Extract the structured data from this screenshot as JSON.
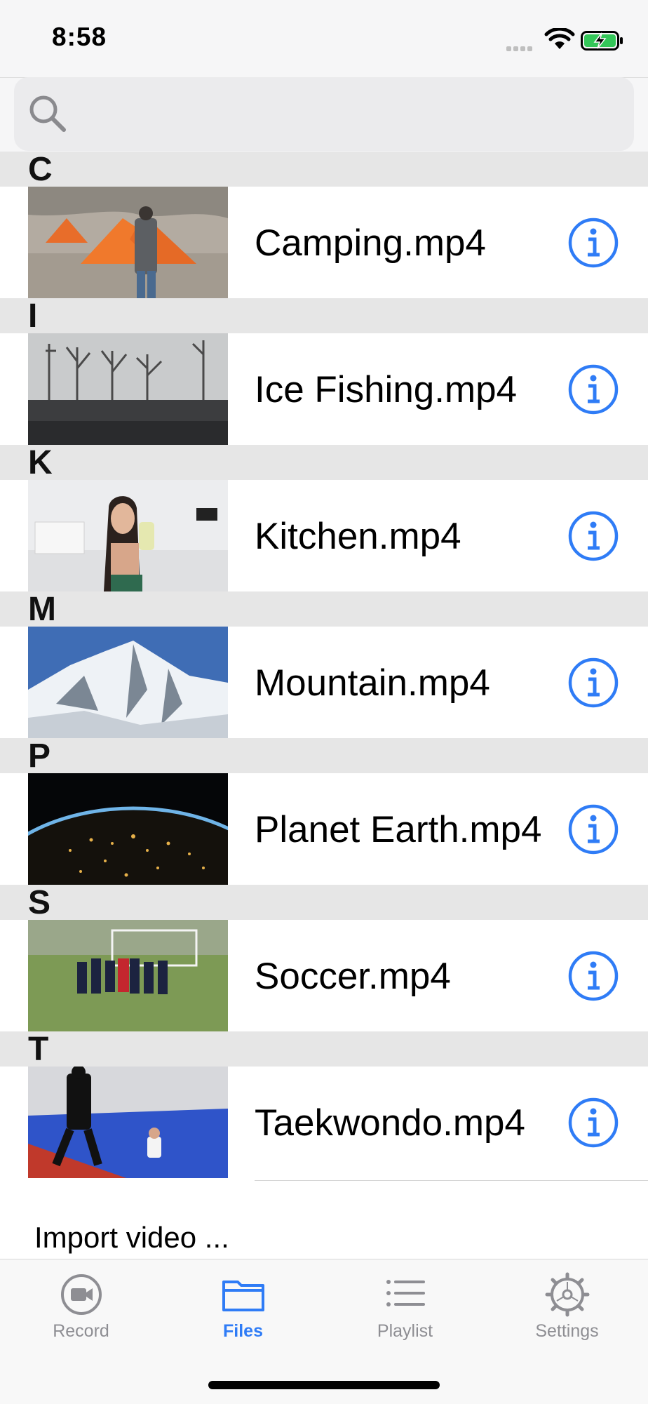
{
  "status_bar": {
    "time": "8:58"
  },
  "search": {
    "placeholder": "",
    "value": ""
  },
  "sections": [
    {
      "letter": "C",
      "file": "Camping.mp4"
    },
    {
      "letter": "I",
      "file": "Ice Fishing.mp4"
    },
    {
      "letter": "K",
      "file": "Kitchen.mp4"
    },
    {
      "letter": "M",
      "file": "Mountain.mp4"
    },
    {
      "letter": "P",
      "file": "Planet Earth.mp4"
    },
    {
      "letter": "S",
      "file": "Soccer.mp4"
    },
    {
      "letter": "T",
      "file": "Taekwondo.mp4"
    }
  ],
  "import": {
    "label": "Import video ..."
  },
  "tabs": [
    {
      "label": "Record",
      "icon": "record-icon"
    },
    {
      "label": "Files",
      "icon": "folder-icon",
      "active": true
    },
    {
      "label": "Playlist",
      "icon": "list-icon"
    },
    {
      "label": "Settings",
      "icon": "gear-icon"
    }
  ],
  "colors": {
    "accent": "#2f7cf6",
    "inactive": "#8e8e93",
    "section_bg": "#e6e6e6"
  }
}
